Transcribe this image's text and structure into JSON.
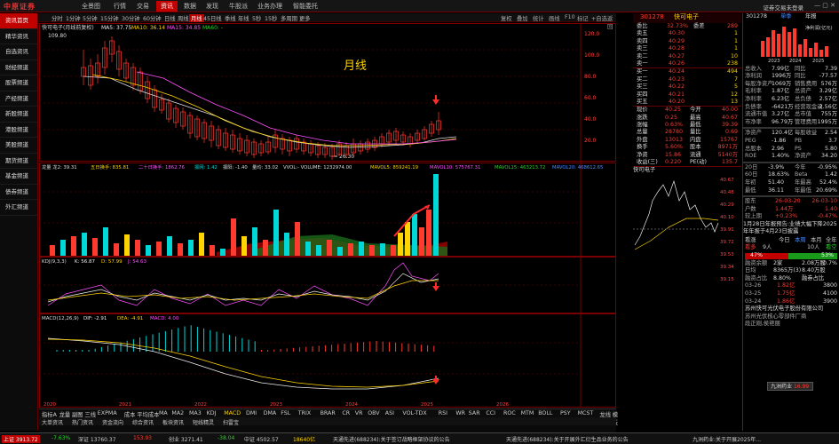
{
  "app": {
    "logo": "中原证券",
    "nav": [
      "全景图",
      "行情",
      "交易",
      "资讯",
      "数据",
      "发现",
      "牛股派",
      "业务办理",
      "智能委托"
    ],
    "active_nav": "资讯",
    "login": "证券交易未登录"
  },
  "sidebar": {
    "items": [
      "资讯首页",
      "精华资讯",
      "自选资讯",
      "财经频道",
      "股票频道",
      "产经频道",
      "新股频道",
      "港股频道",
      "美股频道",
      "期货频道",
      "基金频道",
      "债券频道",
      "外汇频道"
    ],
    "active": 0
  },
  "toolbar": {
    "periods": [
      "分时",
      "1分钟",
      "5分钟",
      "15分钟",
      "30分钟",
      "60分钟",
      "日线",
      "周线",
      "月线",
      "45日线",
      "季线",
      "年线",
      "5秒",
      "15秒",
      "多周期",
      "更多"
    ],
    "active": "月线",
    "right": [
      "复权",
      "叠加",
      "统计",
      "画线",
      "F10",
      "标记",
      "+自选",
      "返回"
    ]
  },
  "main_chart": {
    "title": "快可电子(月线前复权)",
    "ma_label": "MA5: 37.75",
    "ma10": "MA10: 36.14",
    "ma15": "MA15: 34.85",
    "ma60": "MA60: -",
    "high_label": "109.80",
    "low_label": "26.30",
    "watermark": "月线",
    "price_axis": [
      "120.0",
      "100.0",
      "80.0",
      "60.0",
      "40.0",
      "20.0"
    ]
  },
  "volume_panel": {
    "label": "龙量 龙2: 39.31",
    "l1": "五日换手: 835.81",
    "l2": "二十日换手: 1862.76",
    "l3": "振网: 1.42",
    "l4": "振阳: -1.40",
    "l5": "量均: 33.02",
    "l6": "VVOL:- VOLUME: 1232974.00",
    "l7": "MAVOL5: 859241.19",
    "l8": "MAVOL10: 575767.31",
    "l9": "MAVOL15: 463213.72",
    "l10": "MAVOL20: 468612.65"
  },
  "kdj_panel": {
    "label": "KDJ(9,3,3)",
    "k": "K: 56.87",
    "d": "D: 57.99",
    "j": "J: 54.63"
  },
  "macd_panel": {
    "label": "MACD(12,26,9)",
    "dif": "DIF: -2.91",
    "dea": "DEA: -4.91",
    "macd": "MACD: 4.00"
  },
  "date_axis": [
    "2020",
    "2021",
    "2022",
    "2023",
    "2024",
    "2025",
    "2026"
  ],
  "quote": {
    "code": "301278",
    "name": "快可电子",
    "weibi_label": "委比",
    "weibi": "32.73%",
    "weicha_label": "委差",
    "weicha": "289",
    "asks": [
      [
        "卖五",
        "40.30",
        "1"
      ],
      [
        "卖四",
        "40.29",
        "1"
      ],
      [
        "卖三",
        "40.28",
        "1"
      ],
      [
        "卖二",
        "40.27",
        "10"
      ],
      [
        "卖一",
        "40.26",
        "238"
      ]
    ],
    "bids": [
      [
        "买一",
        "40.24",
        "494"
      ],
      [
        "买二",
        "40.23",
        "7"
      ],
      [
        "买三",
        "40.22",
        "5"
      ],
      [
        "买四",
        "40.21",
        "12"
      ],
      [
        "买五",
        "40.20",
        "13"
      ]
    ],
    "stats": [
      [
        "现价",
        "40.25",
        "今开",
        "40.00"
      ],
      [
        "涨跌",
        "0.25",
        "最高",
        "40.67"
      ],
      [
        "涨幅",
        "0.63%",
        "最低",
        "39.39"
      ],
      [
        "总量",
        "28780",
        "量比",
        "0.69"
      ],
      [
        "外盘",
        "13013",
        "内盘",
        "15767"
      ],
      [
        "换手",
        "5.60%",
        "股本",
        "8971万"
      ],
      [
        "净资",
        "15.86",
        "流通",
        "5140万"
      ],
      [
        "收益(三)",
        "0.220",
        "PE(动)",
        "135.7"
      ]
    ]
  },
  "mini_chart": {
    "title": "快可电子",
    "prices": [
      "40.67",
      "40.48",
      "40.29",
      "40.10",
      "39.91",
      "39.72",
      "39.53",
      "39.34",
      "39.15"
    ]
  },
  "farright": {
    "code": "301278",
    "tabs": [
      "单季",
      "年报"
    ],
    "label": "净利润(亿元)",
    "years": [
      "2023",
      "2024",
      "2025"
    ],
    "fin": [
      [
        "总收入",
        "7.99亿",
        "同比",
        "7.39"
      ],
      [
        "净利润",
        "1996万",
        "同比",
        "-77.57"
      ],
      [
        "每股净资产",
        "1069万",
        "销售费用",
        "576万"
      ],
      [
        "毛利率",
        "1.87亿",
        "总资产",
        "3.29亿"
      ],
      [
        "净利率",
        "6.23亿",
        "总负债",
        "2.57亿"
      ],
      [
        "负债率",
        "-6421万",
        "经营现金流",
        "-2.56亿"
      ],
      [
        "流通市值",
        "3.27亿",
        "总市值",
        "755万"
      ],
      [
        "市净率",
        "96.79万",
        "管理费用",
        "1995万"
      ]
    ],
    "metrics": [
      [
        "净资产",
        "120.4亿",
        "每股收益",
        "2.54"
      ],
      [
        "PEG",
        "-1.86",
        "PB",
        "3.7"
      ],
      [
        "总股本",
        "2.96",
        "PS",
        "5.80"
      ],
      [
        "ROE",
        "1.40%",
        "净资产",
        "34.20"
      ]
    ],
    "perf": [
      [
        "20日",
        "-3.9%",
        "今年",
        "-0.95%"
      ],
      [
        "60日",
        "18.63%",
        "Beta",
        "1.42"
      ],
      [
        "年初",
        "51.40",
        "年最高",
        "52.4%"
      ],
      [
        "最低",
        "36.11",
        "年最低",
        "20.69%"
      ]
    ],
    "dividend": [
      [
        "股东",
        "26-03-20",
        "26-03-10"
      ],
      [
        "户数",
        "1.44万",
        "1.40"
      ],
      [
        "较上期",
        "+0.23%",
        "-0.47%"
      ]
    ],
    "report": "1月28日年报预告:业绩大幅下降2025年年报于4月23日披露",
    "sentiment": {
      "label": "看涨",
      "today": "今日",
      "week": "本周",
      "month": "本月",
      "year": "全年",
      "bull_label": "看多",
      "bull_count": "9人",
      "bear_count": "10人",
      "bear_label": "看空",
      "bull_pct": "47%",
      "bear_pct": "53%"
    },
    "margin": [
      [
        "融资余额",
        "2家",
        "2.08万股",
        "0.7%"
      ],
      [
        "日均",
        "8365万(3)",
        "8.40万股"
      ],
      [
        "融资占比",
        "8.80%",
        "融券占比"
      ]
    ],
    "dates": [
      [
        "03-26",
        "1.82亿",
        "3800"
      ],
      [
        "03-25",
        "1.75亿",
        "4100"
      ],
      [
        "03-24",
        "1.86亿",
        "3900"
      ]
    ],
    "company": "苏州快可光伏电子股份有限公司",
    "company2": "苏州光伏核心零部件厂商",
    "legal": "段正刚,侯艳丽",
    "badge": "九洲药业",
    "badge_val": "16.99"
  },
  "indicators": [
    "指标A",
    "龙量",
    "副图",
    "三线",
    "EXPMA",
    "成本",
    "平均成本",
    "MA",
    "MA2",
    "MA3",
    "KDJ",
    "MACD",
    "DMI",
    "DMA",
    "FSL",
    "TRIX",
    "BRAR",
    "CR",
    "VR",
    "OBV",
    "ASI",
    "VOL-TDX",
    "RSI",
    "WR",
    "SAR",
    "CCI",
    "ROC",
    "MTM",
    "BOLL",
    "PSY",
    "MCST",
    "龙线",
    "模板"
  ],
  "tabs2": [
    "大单资讯",
    "热门资讯",
    "资金流向",
    "综合资讯",
    "板块资讯",
    "短线精灵",
    "扫雷宝"
  ],
  "status": {
    "sh": "上证 3913.72",
    "sh_chg": "-7.63%",
    "sz": "深证 13760.37",
    "sz_chg": "153.93",
    "cy": "创业 3271.41",
    "cy_chg": "-38.04",
    "zb": "中证 4502.57",
    "time": "18640亿",
    "news1": "天通先进(688234):关于签订战略框架协议的公告",
    "news2": "天通先进(688234):关于开展外汇衍生品业务的公告",
    "news3": "九洲药业:关于开展2025年..."
  }
}
